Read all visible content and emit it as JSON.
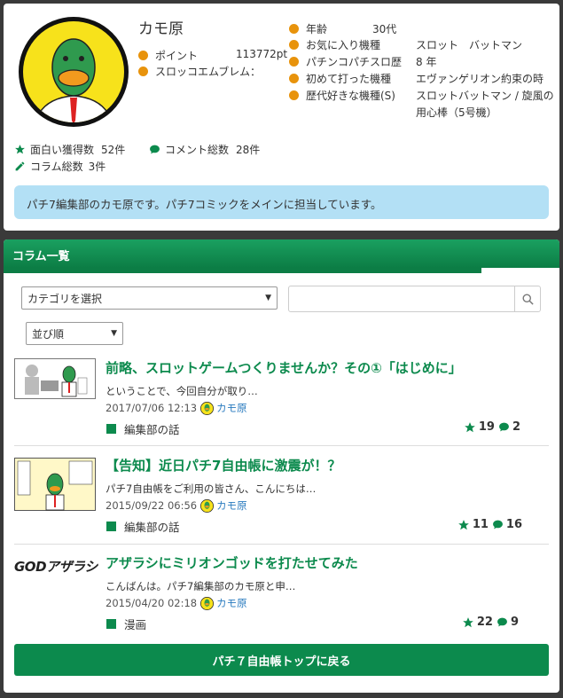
{
  "profile": {
    "name": "カモ原",
    "points_label": "ポイント",
    "points_value": "113772pt",
    "emblem_label": "スロッコエムブレム：",
    "fun_label": "面白い獲得数",
    "fun_value": "52件",
    "comment_label": "コメント総数",
    "comment_value": "28件",
    "column_label": "コラム総数",
    "column_value": "3件",
    "details": [
      {
        "label": "年齢",
        "value": "30代"
      },
      {
        "label": "お気に入り機種",
        "value": "スロット　バットマン"
      },
      {
        "label": "パチンコパチスロ歴",
        "value": "8 年"
      },
      {
        "label": "初めて打った機種",
        "value": "エヴァンゲリオン約束の時"
      },
      {
        "label": "歴代好きな機種(S)",
        "value": "スロットバットマン / 旋風の",
        "value2": "用心棒（5号機）"
      }
    ],
    "bio": "パチ7編集部のカモ原です。パチ7コミックをメインに担当しています。"
  },
  "columns": {
    "header": "コラム一覧",
    "category_select": "カテゴリを選択",
    "sort_select": "並び順",
    "search_placeholder": "",
    "articles": [
      {
        "title": "前略、スロットゲームつくりませんか？その①「はじめに」",
        "excerpt": "ということで、今回自分が取り…",
        "date": "2017/07/06 12:13",
        "author": "カモ原",
        "category": "編集部の話",
        "likes": "19",
        "comments": "2"
      },
      {
        "title": "【告知】近日パチ7自由帳に激震が！？",
        "excerpt": "パチ7自由帳をご利用の皆さん、こんにちは…",
        "date": "2015/09/22 06:56",
        "author": "カモ原",
        "category": "編集部の話",
        "likes": "11",
        "comments": "16"
      },
      {
        "title": "アザラシにミリオンゴッドを打たせてみた",
        "excerpt": "こんばんは。パチ7編集部のカモ原と申…",
        "date": "2015/04/20 02:18",
        "author": "カモ原",
        "category": "漫画",
        "likes": "22",
        "comments": "9",
        "thumb_text": "GODアザラシ"
      }
    ],
    "back_button": "パチ７自由帳トップに戻る"
  },
  "colors": {
    "accent_green": "#0c8a4d",
    "orange_dot": "#e8930c",
    "bio_bg": "#b3e0f5"
  }
}
